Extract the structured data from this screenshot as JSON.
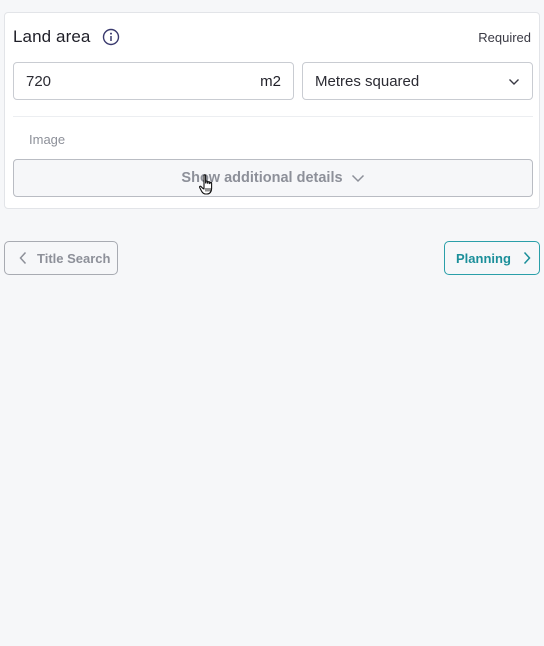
{
  "land_area": {
    "title": "Land area",
    "required_label": "Required",
    "value": "720",
    "unit_suffix": "m2",
    "unit_select": {
      "selected": "Metres squared"
    },
    "image_label": "Image",
    "details_button_label": "Show additional details"
  },
  "navigation": {
    "back_label": "Title Search",
    "next_label": "Planning"
  },
  "colors": {
    "accent": "#1b8f9a",
    "info_icon": "#3a3a6e",
    "muted_text": "#8d9099"
  },
  "icons": [
    "info-icon",
    "chevron-down-icon",
    "chevron-left-icon",
    "chevron-right-icon",
    "hand-pointer-cursor-icon"
  ]
}
